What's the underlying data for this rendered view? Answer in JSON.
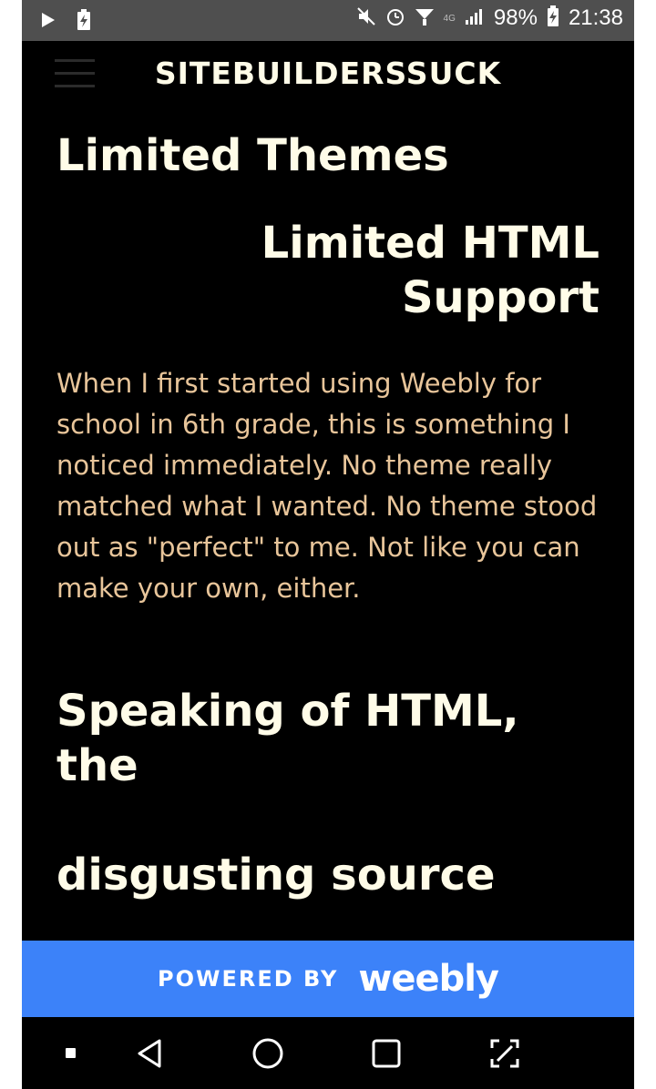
{
  "status_bar": {
    "battery_percent": "98%",
    "time": "21:38",
    "network": "4G",
    "icons": [
      "play-icon",
      "battery-charging-icon",
      "mute-icon",
      "alarm-icon",
      "wifi-icon",
      "signal-icon",
      "battery-icon"
    ]
  },
  "header": {
    "site_title": "SITEBUILDERSSUCK",
    "menu_icon": "hamburger-menu-icon"
  },
  "main": {
    "heading_1": "Limited Themes",
    "heading_2": "Limited HTML Support",
    "paragraph": "When I first started using Weebly for school in 6th grade, this is something I noticed immediately. No theme really matched what I wanted. No theme stood out as \"perfect\" to me. Not like you can make your own, either.",
    "heading_3": "Speaking of HTML, the",
    "heading_4": "disgusting source"
  },
  "footer": {
    "powered_by": "POWERED BY",
    "brand": "weebly"
  },
  "nav_bar": {
    "icons": [
      "square-dot-icon",
      "back-triangle-icon",
      "home-circle-icon",
      "recents-square-icon",
      "screenshot-edit-icon"
    ]
  },
  "colors": {
    "background": "#000000",
    "heading": "#fffce8",
    "paragraph": "#e8c59a",
    "footer": "#3c82f9",
    "status_bar": "#4f4f4f"
  }
}
